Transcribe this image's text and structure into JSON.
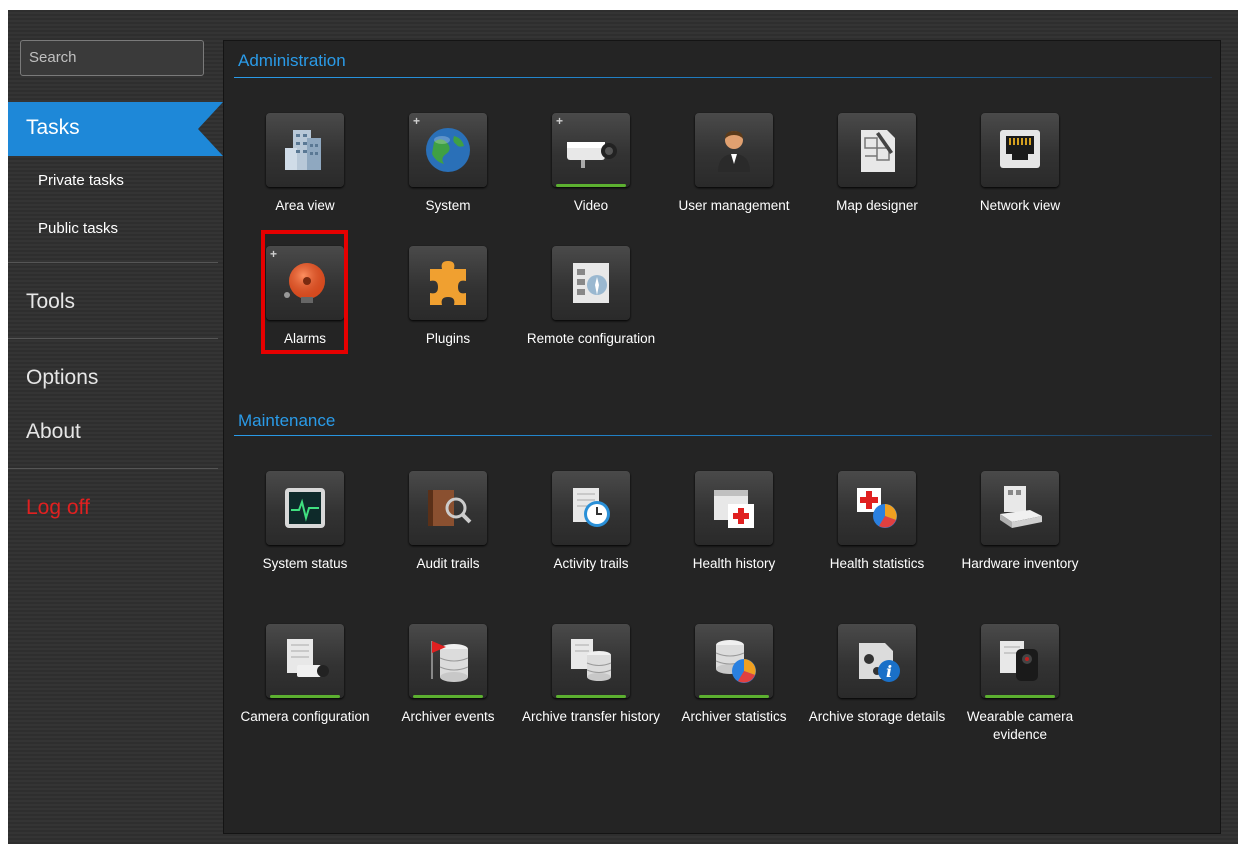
{
  "search": {
    "placeholder": "Search"
  },
  "nav": {
    "tasks": "Tasks",
    "private_tasks": "Private tasks",
    "public_tasks": "Public tasks",
    "tools": "Tools",
    "options": "Options",
    "about": "About",
    "log_off": "Log off"
  },
  "colors": {
    "accent": "#1e88d8",
    "section": "#2a9be8",
    "logoff": "#e02020",
    "highlight": "#e60000",
    "indicator": "#5cb030"
  },
  "administration": {
    "title": "Administration",
    "tiles": [
      {
        "label": "Area view",
        "icon": "buildings-icon"
      },
      {
        "label": "System",
        "icon": "globe-icon"
      },
      {
        "label": "Video",
        "icon": "camera-icon"
      },
      {
        "label": "User management",
        "icon": "user-icon"
      },
      {
        "label": "Map designer",
        "icon": "map-icon"
      },
      {
        "label": "Network view",
        "icon": "network-port-icon"
      },
      {
        "label": "Alarms",
        "icon": "alarm-bell-icon"
      },
      {
        "label": "Plugins",
        "icon": "puzzle-icon"
      },
      {
        "label": "Remote configuration",
        "icon": "remote-config-icon"
      }
    ]
  },
  "maintenance": {
    "title": "Maintenance",
    "tiles": [
      {
        "label": "System status",
        "icon": "monitor-pulse-icon"
      },
      {
        "label": "Audit trails",
        "icon": "audit-book-icon"
      },
      {
        "label": "Activity trails",
        "icon": "clock-document-icon"
      },
      {
        "label": "Health history",
        "icon": "calendar-health-icon"
      },
      {
        "label": "Health statistics",
        "icon": "health-pie-icon"
      },
      {
        "label": "Hardware inventory",
        "icon": "hardware-icon"
      },
      {
        "label": "Camera configuration",
        "icon": "camera-document-icon"
      },
      {
        "label": "Archiver events",
        "icon": "database-flag-icon"
      },
      {
        "label": "Archive transfer history",
        "icon": "database-document-icon"
      },
      {
        "label": "Archiver statistics",
        "icon": "database-pie-icon"
      },
      {
        "label": "Archive storage details",
        "icon": "storage-info-icon"
      },
      {
        "label": "Wearable camera evidence",
        "icon": "bodycam-icon"
      }
    ]
  }
}
